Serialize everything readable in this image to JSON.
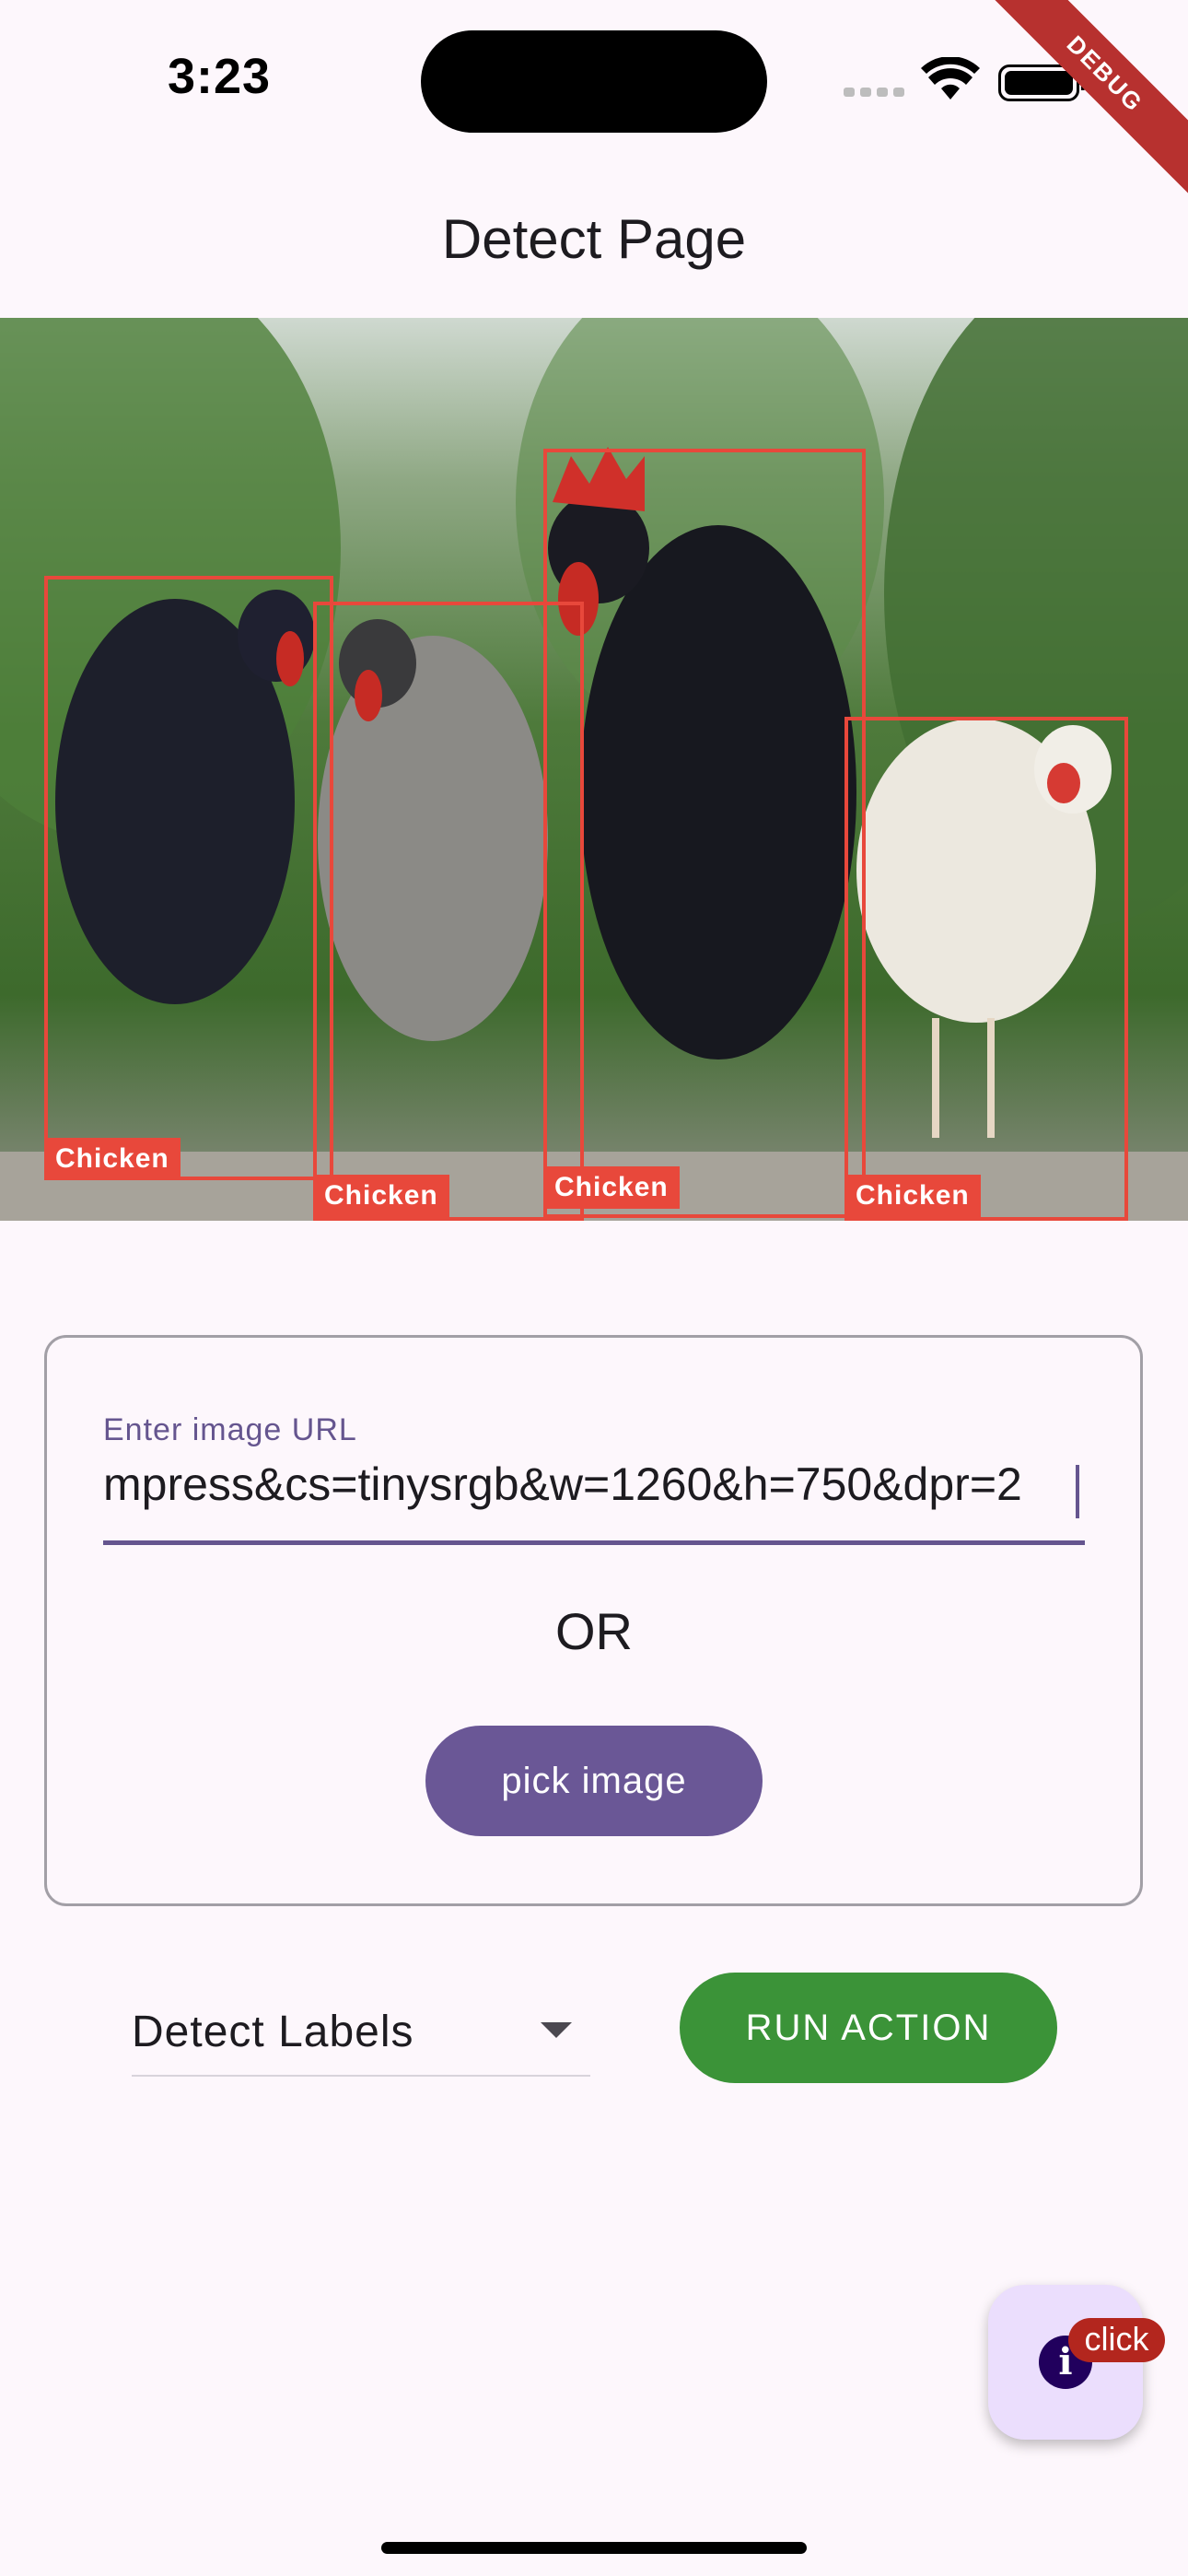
{
  "status_bar": {
    "time": "3:23"
  },
  "debug_banner": "DEBUG",
  "app_bar": {
    "title": "Detect Page"
  },
  "detections": [
    {
      "label": "Chicken"
    },
    {
      "label": "Chicken"
    },
    {
      "label": "Chicken"
    },
    {
      "label": "Chicken"
    }
  ],
  "form": {
    "url_label": "Enter image URL",
    "url_value": "mpress&cs=tinysrgb&w=1260&h=750&dpr=2",
    "or_text": "OR",
    "pick_button": "pick image"
  },
  "action": {
    "selected": "Detect Labels",
    "run_button": "RUN ACTION"
  },
  "fab": {
    "icon": "info-icon",
    "badge": "click"
  },
  "colors": {
    "accent": "#6a5796",
    "run": "#3b9338",
    "box": "#e8483b",
    "badge": "#b3261e"
  }
}
